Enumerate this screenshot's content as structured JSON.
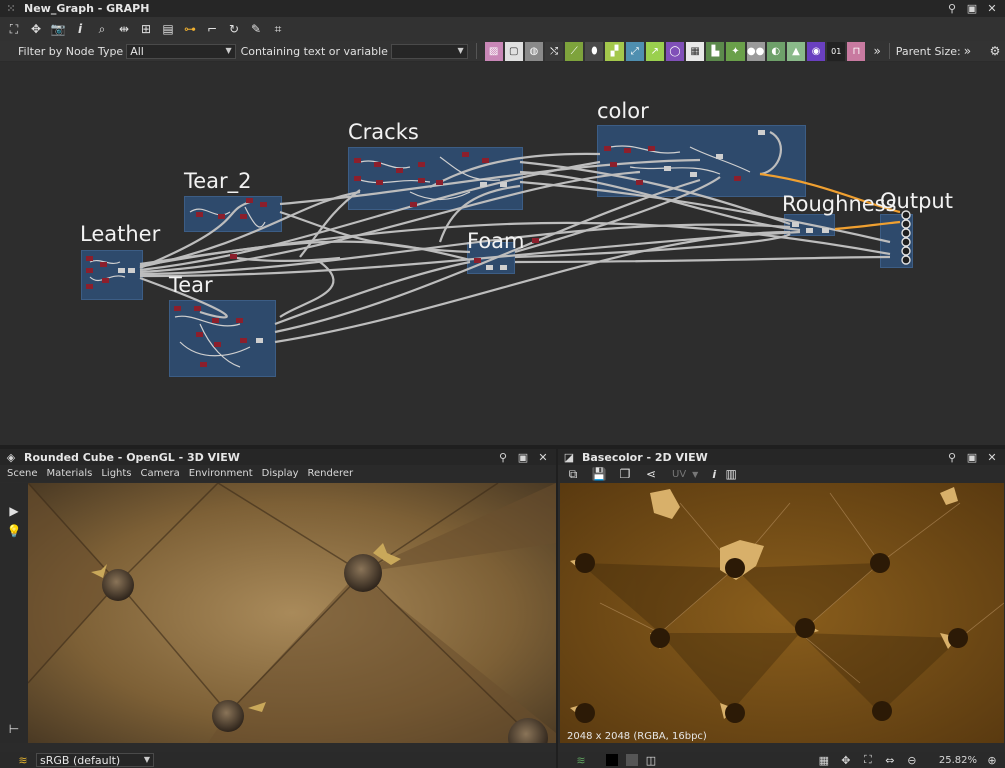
{
  "graph": {
    "title": "New_Graph - GRAPH",
    "filter_label": "Filter by Node Type",
    "filter_value": "All",
    "search_label": "Containing text or variable",
    "search_value": "",
    "parent_size_label": "Parent Size:",
    "parent_size_chevron": "»",
    "more_chevron": "»",
    "frames": [
      {
        "label": "Leather"
      },
      {
        "label": "Tear_2"
      },
      {
        "label": "Tear"
      },
      {
        "label": "Cracks"
      },
      {
        "label": "Foam"
      },
      {
        "label": "color"
      },
      {
        "label": "Roughness"
      },
      {
        "label": "Output"
      }
    ]
  },
  "view3d": {
    "title": "Rounded Cube - OpenGL - 3D VIEW",
    "menu": [
      "Scene",
      "Materials",
      "Lights",
      "Camera",
      "Environment",
      "Display",
      "Renderer"
    ],
    "colorspace": "sRGB (default)"
  },
  "view2d": {
    "title": "Basecolor - 2D VIEW",
    "uv_label": "UV",
    "info_label": "i",
    "resolution": "2048 x 2048 (RGBA, 16bpc)",
    "zoom": "25.82%"
  },
  "colors": {
    "frame_fill": "#2e4a6c",
    "node_red": "#8c1f2c",
    "wire": "#bdbdbd",
    "wire_highlight": "#f0a030",
    "leather_brown": "#7a5a32"
  }
}
